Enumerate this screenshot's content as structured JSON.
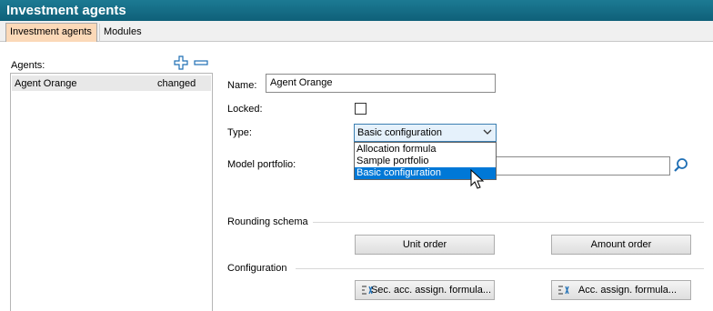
{
  "window": {
    "title": "Investment agents"
  },
  "tabs": [
    {
      "label": "Investment agents",
      "active": true
    },
    {
      "label": "Modules",
      "active": false
    }
  ],
  "agents": {
    "label": "Agents:",
    "items": [
      {
        "name": "Agent Orange",
        "status": "changed"
      }
    ]
  },
  "form": {
    "name_label": "Name:",
    "name_value": "Agent Orange",
    "locked_label": "Locked:",
    "locked": false,
    "type_label": "Type:",
    "type_value": "Basic configuration",
    "type_options": [
      "Allocation formula",
      "Sample portfolio",
      "Basic configuration"
    ],
    "model_portfolio_label": "Model portfolio:",
    "model_portfolio_value": ""
  },
  "rounding": {
    "title": "Rounding schema",
    "unit_order_label": "Unit order",
    "amount_order_label": "Amount order"
  },
  "configuration": {
    "title": "Configuration",
    "sec_formula_label": "Sec. acc. assign. formula...",
    "acc_formula_label": "Acc. assign. formula..."
  },
  "colors": {
    "titlebar": "#11667f",
    "active_tab": "#fbd9b8",
    "selection": "#0078d7",
    "accent_icon": "#1f6fb5"
  }
}
